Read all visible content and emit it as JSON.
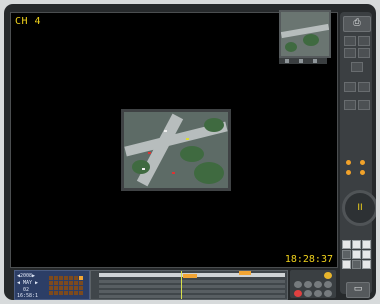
{
  "window": {
    "channel_label": "CH 4",
    "clock": "18:28:37"
  },
  "side_panel": {
    "top_button_icon": "capture-icon",
    "exit_button_icon": "exit-icon"
  },
  "ptz": {
    "center_label": "II"
  },
  "calendar": {
    "year_line": "◀2008▶",
    "month_line": "◀ MAY ▶",
    "day_line": "02",
    "time_line": "16:58:1"
  },
  "colors": {
    "accent": "#f0d21c",
    "timeline_mark": "#f2a534",
    "panel_bg": "#26292b"
  }
}
